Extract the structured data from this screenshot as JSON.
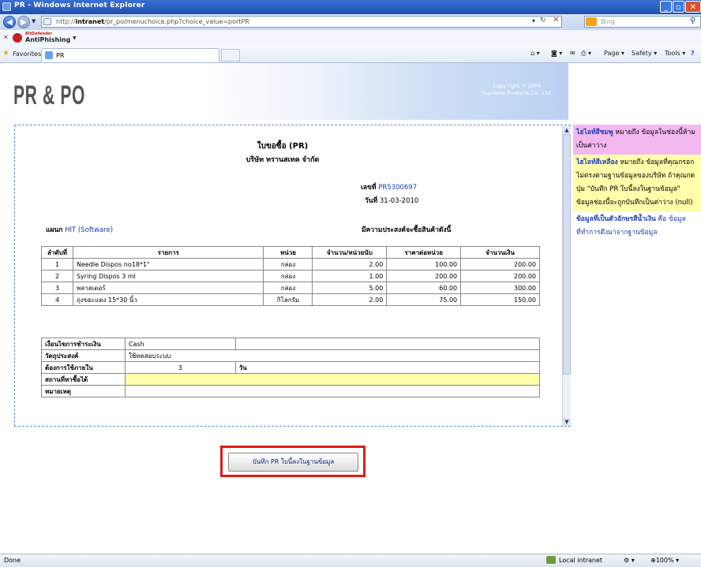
{
  "browser": {
    "window_title": "PR - Windows Internet Explorer",
    "url_prefix": "http://",
    "url_host": "intranet",
    "url_path": "/pr_po/menuchoice.php?choice_value=portPR",
    "search_placeholder": "Bing",
    "antiphishing_label": "AntiPhishing",
    "antiphishing_brand": "BitDefender",
    "favorites_label": "Favorites",
    "tab_label": "PR",
    "toolbar": {
      "page": "Page",
      "safety": "Safety",
      "tools": "Tools"
    }
  },
  "header": {
    "logo": "PR & PO",
    "copyright_line1": "Copy right © 2006",
    "copyright_line2": "Supreme Products Co., Ltd."
  },
  "document": {
    "title": "ใบขอซื้อ (PR)",
    "company": "บริษัท ทรานสเทค จำกัด",
    "number_label": "เลขที่",
    "number_value": "PR5300697",
    "date_label": "วันที่",
    "date_value": "31-03-2010",
    "dept_label": "แผนก",
    "dept_value": "HIT (Software)",
    "intent_text": "มีความประสงค์จะซื้อสินค้าดังนี้",
    "columns": [
      "ลำดับที่",
      "รายการ",
      "หน่วย",
      "จำนวน/หน่วยนับ",
      "ราคาต่อหน่วย",
      "จำนวนเงิน"
    ],
    "items": [
      {
        "no": "1",
        "name": "Needle Dispos no18*1\"",
        "unit": "กล่อง",
        "qty": "2.00",
        "price": "100.00",
        "amount": "200.00"
      },
      {
        "no": "2",
        "name": "Syring Dispos 3 ml",
        "unit": "กล่อง",
        "qty": "1.00",
        "price": "200.00",
        "amount": "200.00"
      },
      {
        "no": "3",
        "name": "พลาสเตอร์",
        "unit": "กล่อง",
        "qty": "5.00",
        "price": "60.00",
        "amount": "300.00"
      },
      {
        "no": "4",
        "name": "ถุงขยะแดง 15*30 นิ้ว",
        "unit": "กิโลกรัม",
        "qty": "2.00",
        "price": "75.00",
        "amount": "150.00"
      }
    ],
    "terms_label": "เงื่อนไขการชำระเงิน",
    "terms_value": "Cash",
    "purpose_label": "วัตถุประสงค์",
    "purpose_value": "ใช้ทดสอบระบบ",
    "needed_label": "ต้องการใช้ภายใน",
    "needed_value": "3",
    "needed_unit": "วัน",
    "source_label": "สถานที่หาซื้อได้",
    "source_value": "",
    "note_label": "หมายเหตุ",
    "note_value": ""
  },
  "save_button_label": "บันทึก PR ใบนี้ลงในฐานข้อมูล",
  "legend": {
    "pink_title": "ไฮไลท์สีชมพู",
    "pink_text": " หมายถึง ข้อมูลในช่องนี้ห้ามเป็นค่าว่าง",
    "yellow_title": "ไฮไลท์สีเหลือง",
    "yellow_text": " หมายถึง ข้อมูลที่คุณกรอกไม่ตรงตามฐานข้อมูลของบริษัท ถ้าคุณกดปุ่ม \"บันทึก PR ใบนี้ลงในฐานข้อมูล\" ข้อมูลช่องนี้จะถูกบันทึกเป็นค่าว่าง (null)",
    "blue_title": "ข้อมูลที่เป็นตัวอักษรสีน้ำเงิน",
    "blue_text": " คือ ข้อมูลที่ทำการดึงมาจากฐานข้อมูล"
  },
  "status": {
    "left": "Done",
    "zone": "Local intranet",
    "zoom": "100%"
  },
  "colors": {
    "pink_highlight": "#f4b8f0",
    "yellow_highlight": "#fdfdaa",
    "data_blue": "#1a3bb0",
    "highlight_box": "#e01a1a"
  }
}
